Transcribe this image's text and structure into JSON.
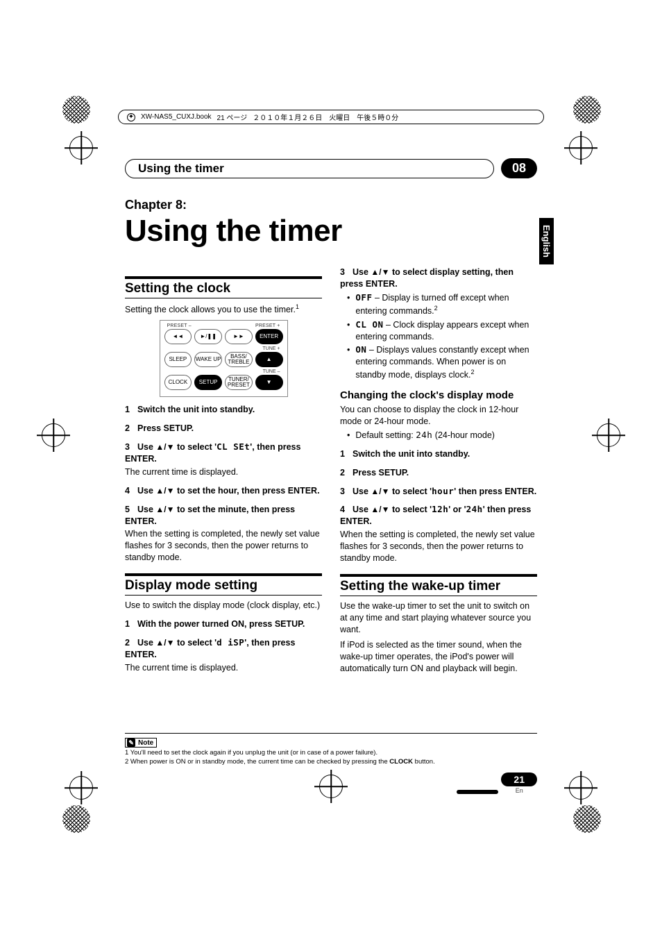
{
  "sheet_header": {
    "file": "XW-NAS5_CUXJ.book",
    "page_text": "21 ページ",
    "date": "２０１０年１月２６日　火曜日　午後５時０分"
  },
  "header": {
    "title": "Using the timer",
    "section_number": "08"
  },
  "side_tab": "English",
  "chapter": {
    "label": "Chapter 8:",
    "title": "Using the timer"
  },
  "remote": {
    "top_labels": {
      "left": "PRESET –",
      "right": "PRESET +"
    },
    "row1": [
      "◄◄",
      "►/❚❚",
      "►►",
      "ENTER"
    ],
    "row2_label_right": "TUNE +",
    "row2": [
      "SLEEP",
      "WAKE UP",
      "BASS/ TREBLE",
      "▲"
    ],
    "row3_label_right": "TUNE –",
    "row3": [
      "CLOCK",
      "SETUP",
      "TUNER/ PRESET",
      "▼"
    ]
  },
  "left": {
    "h2a": "Setting the clock",
    "p_intro": "Setting the clock allows you to use the timer.",
    "sup1": "1",
    "s1": "Switch the unit into standby.",
    "s2": "Press SETUP.",
    "s3a": "Use ",
    "s3b": " to select '",
    "s3seg": "CL  SEt",
    "s3c": "', then press ENTER.",
    "s3after": "The current time is displayed.",
    "s4a": "Use ",
    "s4b": " to set the hour, then press ENTER.",
    "s5a": "Use ",
    "s5b": " to set the minute, then press ENTER.",
    "s5after": "When the setting is completed, the newly set value flashes for 3 seconds, then the power returns to standby mode.",
    "h2b": "Display mode setting",
    "p_disp": "Use to switch the display mode (clock display, etc.)",
    "d1": "With the power turned ON, press SETUP.",
    "d2a": "Use ",
    "d2b": " to select '",
    "d2seg": "d iSP",
    "d2c": "', then press ENTER.",
    "d2after": "The current time is displayed."
  },
  "right": {
    "r3a": "Use ",
    "r3b": " to select display setting, then press ENTER.",
    "b1seg": "OFF",
    "b1": " – Display is turned off except when entering commands.",
    "b1sup": "2",
    "b2seg": "CL  ON",
    "b2": " – Clock display appears except when entering commands.",
    "b3seg": "ON",
    "b3": " – Displays values constantly except when entering commands. When power is on standby mode, displays clock.",
    "b3sup": "2",
    "h3": "Changing the clock's display mode",
    "h3p": "You can choose to display the clock in 12-hour mode or 24-hour mode.",
    "def_lead": "Default setting: ",
    "def_seg": "24h",
    "def_tail": " (24-hour mode)",
    "c1": "Switch the unit into standby.",
    "c2": "Press SETUP.",
    "c3a": "Use ",
    "c3b": " to select '",
    "c3seg": "hour",
    "c3c": "' then press ENTER.",
    "c4a": "Use ",
    "c4b": " to select '",
    "c4seg1": "12h",
    "c4mid": "' or '",
    "c4seg2": "24h",
    "c4c": "' then press ENTER.",
    "c4after": "When the setting is completed, the newly set value flashes for 3 seconds, then the power returns to standby mode.",
    "h2c": "Setting the wake-up timer",
    "wp1": "Use the wake-up timer to set the unit to switch on at any time and start playing whatever source you want.",
    "wp2": "If iPod is selected as the timer sound, when the wake-up timer operates, the iPod's power will automatically turn ON and playback will begin."
  },
  "notes": {
    "label": "Note",
    "n1": "1 You'll need to set the clock again if you unplug the unit (or in case of a power failure).",
    "n2a": "2 When power is ON or in standby mode, the current time can be checked by pressing the ",
    "n2b": "CLOCK",
    "n2c": " button."
  },
  "page_number": "21",
  "page_lang": "En",
  "arrows": "▲/▼"
}
